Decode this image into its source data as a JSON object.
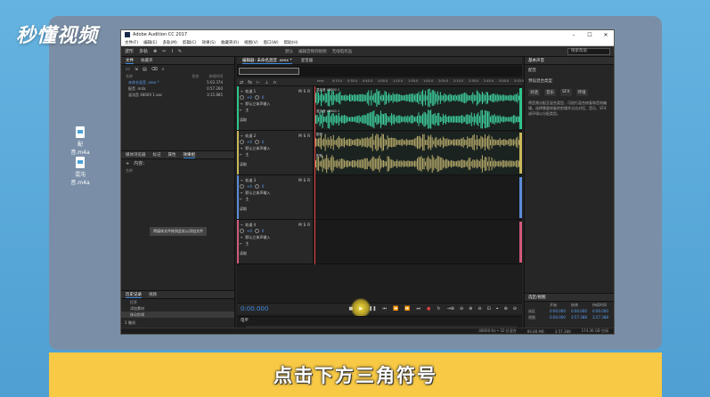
{
  "watermark": "秒懂视频",
  "subtitle": "点击下方三角符号",
  "desktop_icons": [
    "配音.m4a",
    "混沌音.m4a"
  ],
  "app": {
    "title": "Adobe Audition CC 2017",
    "menu": [
      "文件(F)",
      "编辑(E)",
      "多轨(M)",
      "剪辑(C)",
      "效果(S)",
      "收藏夹(R)",
      "视图(V)",
      "窗口(W)",
      "帮助(H)"
    ],
    "toolbar": {
      "waveform": "波形",
      "multitrack": "多轨",
      "workspace_default": "默认",
      "workspace_edit": "编辑音频到视频",
      "workspace_radio": "无线电作品",
      "search_placeholder": "搜索帮助"
    },
    "left": {
      "tabs": [
        "文件",
        "收藏夹"
      ],
      "file_headers": [
        "名称",
        "状态",
        "持续时间"
      ],
      "files": [
        {
          "name": "未命名混音 .sesx *",
          "duration": "5:03.374"
        },
        {
          "name": "配音 .m4a",
          "duration": "0:57.260"
        },
        {
          "name": "混沌音 48000 1.aac",
          "duration": "3:15.885"
        }
      ],
      "media_tabs": [
        "媒体浏览器",
        "标记",
        "属性",
        "效果组"
      ],
      "media_label": "内容：",
      "media_hint": "将媒体文件拖到此处以添加文件",
      "media_name_header": "名称",
      "history_tabs": [
        "历史记录",
        "视频"
      ],
      "history": [
        "打开",
        "添加素材",
        "移动剪辑"
      ],
      "undo_count": "2 撤消"
    },
    "editor": {
      "tabs": [
        "编辑器: 未命名混音 .sesx *",
        "混音器"
      ],
      "ruler_ticks": [
        "hms",
        "0:15.0",
        "0:30.0",
        "0:45.0",
        "1:00.0",
        "1:15.0",
        "1:30.0",
        "1:45.0",
        "2:00.0",
        "2:15.0",
        "2:30.0",
        "2:45.0",
        "3:00.0",
        "3:15.0"
      ],
      "tracks": [
        {
          "name": "轨道 1",
          "volume": "+0",
          "pan": "0",
          "input": "默认立体声输入",
          "output": "主",
          "mode": "读取",
          "color": "#31c48d",
          "clips": [
            {
              "label": "混沌音 48000 1",
              "color": "#3fd4a2"
            },
            {
              "label": "混沌音 48000 1",
              "color": "#3fd4a2"
            }
          ]
        },
        {
          "name": "轨道 2",
          "volume": "+0",
          "pan": "0",
          "input": "默认立体声输入",
          "output": "主",
          "mode": "读取",
          "color": "#c8b85a",
          "clips": [
            {
              "label": "配音",
              "color": "#b5a96a"
            },
            {
              "label": "配音",
              "color": "#b5a96a"
            }
          ]
        },
        {
          "name": "轨道 3",
          "volume": "+0",
          "pan": "0",
          "input": "默认立体声输入",
          "output": "主",
          "mode": "读取",
          "color": "#5a8cd8",
          "clips": []
        },
        {
          "name": "轨道 4",
          "volume": "+0",
          "pan": "0",
          "input": "默认立体声输入",
          "output": "主",
          "mode": "读取",
          "color": "#d05a7a",
          "clips": []
        }
      ],
      "time": "0:00.000",
      "levels_label": "电平",
      "level_scale": [
        "dB",
        "-57",
        "-54",
        "-51",
        "-48",
        "-45",
        "-42",
        "-39",
        "-36",
        "-33",
        "-30",
        "-27",
        "-24",
        "-21",
        "-18",
        "-15",
        "-12",
        "-9",
        "-6",
        "-3",
        "0"
      ]
    },
    "right": {
      "header": "基本声音",
      "line1": "配音",
      "line2": "预设混合类型",
      "types": [
        "对话",
        "音乐",
        "SFX",
        "环境"
      ],
      "desc": "将音频分配至混合类型，可进行混合修复和音效编辑。选择需要修复的剪辑并点击对话、音乐、SFX 或环境以分配类型。",
      "selection_header": "选区/视图",
      "sel_headers": [
        "开始",
        "结束",
        "持续时间"
      ],
      "sel_rows": [
        {
          "label": "选区",
          "start": "0:00.000",
          "end": "0:00.000",
          "dur": "0:00.000"
        },
        {
          "label": "视图",
          "start": "0:00.000",
          "end": "3:57.388",
          "dur": "3:57.388"
        }
      ]
    },
    "status": [
      "48000 Hz • 32 位混合",
      "86.88 MB",
      "3:57.388",
      "174.36 GB 空闲"
    ]
  }
}
